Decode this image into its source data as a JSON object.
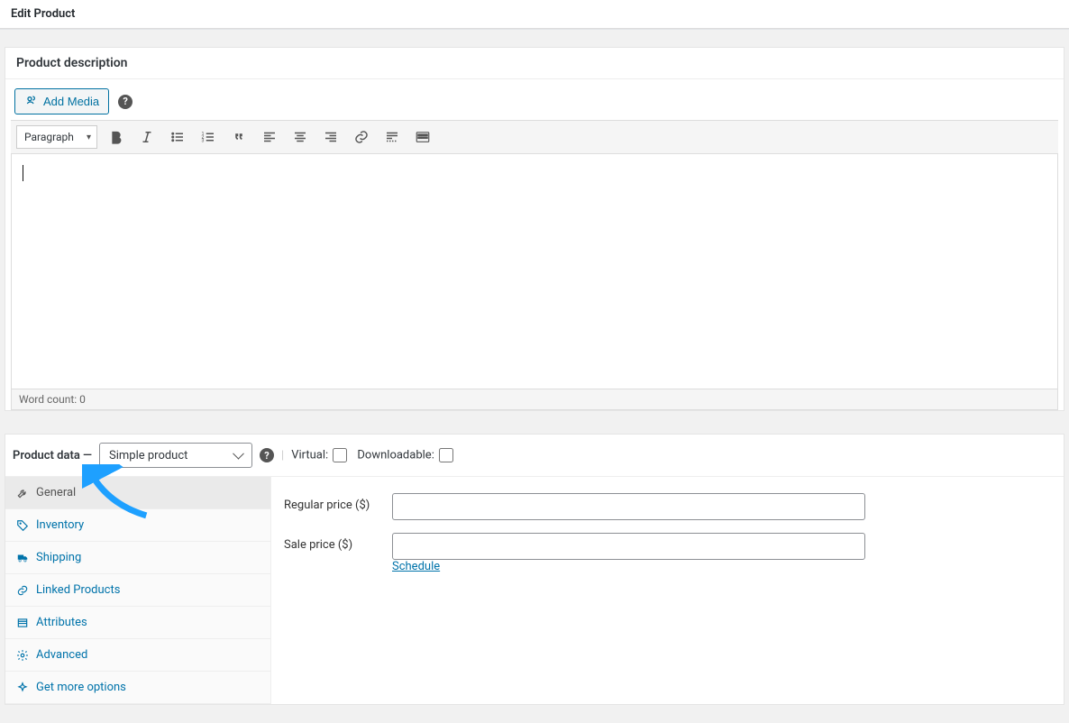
{
  "page": {
    "title": "Edit Product"
  },
  "description_panel": {
    "heading": "Product description",
    "add_media": "Add Media",
    "format": "Paragraph",
    "word_count": "Word count: 0"
  },
  "product_data": {
    "label": "Product data —",
    "type": "Simple product",
    "virtual_label": "Virtual:",
    "downloadable_label": "Downloadable:",
    "tabs": [
      {
        "key": "general",
        "label": "General"
      },
      {
        "key": "inventory",
        "label": "Inventory"
      },
      {
        "key": "shipping",
        "label": "Shipping"
      },
      {
        "key": "linked",
        "label": "Linked Products"
      },
      {
        "key": "attributes",
        "label": "Attributes"
      },
      {
        "key": "advanced",
        "label": "Advanced"
      },
      {
        "key": "more",
        "label": "Get more options"
      }
    ],
    "fields": {
      "regular_label": "Regular price ($)",
      "sale_label": "Sale price ($)",
      "schedule": "Schedule"
    }
  }
}
